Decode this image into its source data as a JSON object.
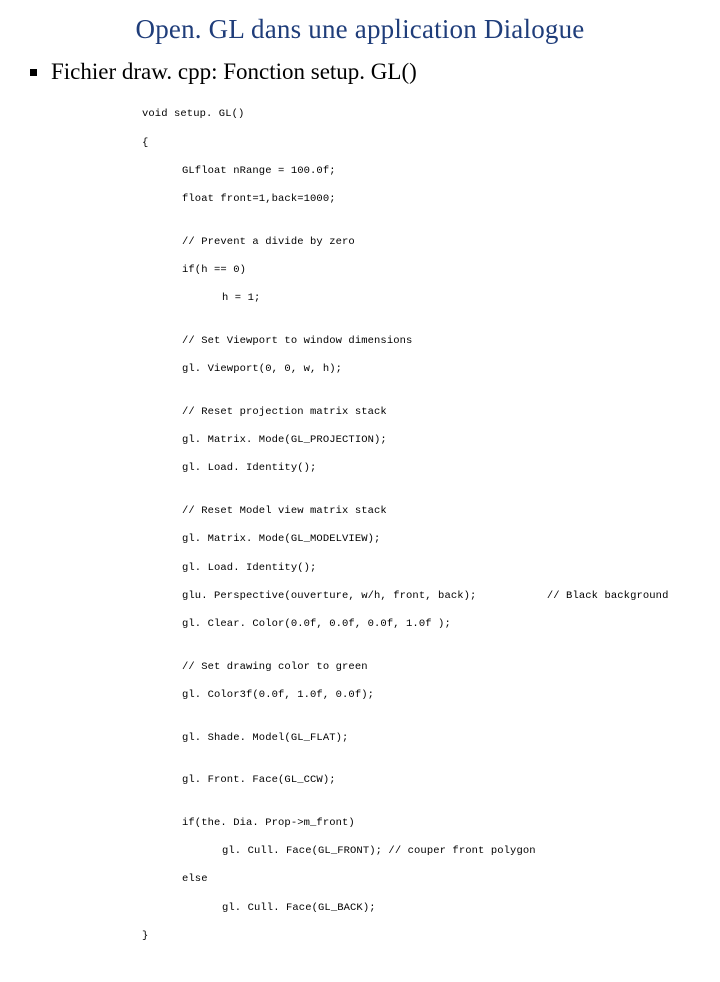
{
  "title": "Open. GL dans une application Dialogue",
  "bullet": "Fichier draw. cpp: Fonction setup. GL()",
  "code": {
    "l00": "void setup. GL()",
    "l01": "{",
    "l02": "GLfloat nRange = 100.0f;",
    "l03": "float front=1,back=1000;",
    "l04": "",
    "l05": "// Prevent a divide by zero",
    "l06": "if(h == 0)",
    "l07": "h = 1;",
    "l08": "",
    "l09": "// Set Viewport to window dimensions",
    "l10": "gl. Viewport(0, 0, w, h);",
    "l11": "",
    "l12": "// Reset projection matrix stack",
    "l13": "gl. Matrix. Mode(GL_PROJECTION);",
    "l14": "gl. Load. Identity();",
    "l15": "",
    "l16": "// Reset Model view matrix stack",
    "l17": "gl. Matrix. Mode(GL_MODELVIEW);",
    "l18": "gl. Load. Identity();",
    "l19": "glu. Perspective(ouverture, w/h, front, back);           // Black background",
    "l20": "gl. Clear. Color(0.0f, 0.0f, 0.0f, 1.0f );",
    "l21": "",
    "l22": "// Set drawing color to green",
    "l23": "gl. Color3f(0.0f, 1.0f, 0.0f);",
    "l24": "",
    "l25": "gl. Shade. Model(GL_FLAT);",
    "l26": "",
    "l27": "gl. Front. Face(GL_CCW);",
    "l28": "",
    "l29": "if(the. Dia. Prop->m_front)",
    "l30": "gl. Cull. Face(GL_FRONT); // couper front polygon",
    "l31": "else",
    "l32": "gl. Cull. Face(GL_BACK);",
    "l33": "}"
  }
}
